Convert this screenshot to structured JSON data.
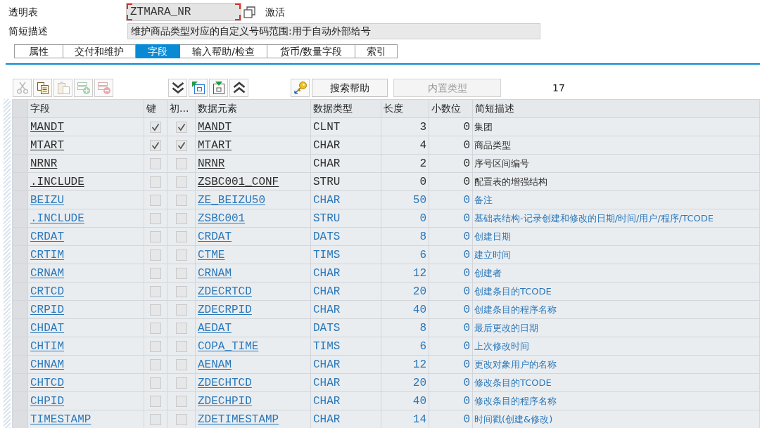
{
  "header": {
    "table_label": "透明表",
    "table_name": "ZTMARA_NR",
    "name_focused": true,
    "status": "激活",
    "description_label": "简短描述",
    "description": "维护商品类型对应的自定义号码范围:用于自动外部给号"
  },
  "tabs": [
    {
      "label": "属性",
      "selected": false
    },
    {
      "label": "交付和维护",
      "selected": false
    },
    {
      "label": "字段",
      "selected": true
    },
    {
      "label": "输入帮助/检查",
      "selected": false
    },
    {
      "label": "货币/数量字段",
      "selected": false
    },
    {
      "label": "索引",
      "selected": false
    }
  ],
  "toolbar": {
    "groups": [
      {
        "items": [
          {
            "kind": "cut",
            "disabled": true
          },
          {
            "kind": "copy",
            "disabled": false
          },
          {
            "kind": "paste",
            "disabled": true
          },
          {
            "kind": "insert_row",
            "disabled": true
          },
          {
            "kind": "delete_row",
            "disabled": true
          }
        ]
      },
      {
        "items": [
          {
            "kind": "expand_all",
            "disabled": false
          },
          {
            "kind": "flag_frame",
            "disabled": false
          },
          {
            "kind": "marker_frame",
            "disabled": false
          },
          {
            "kind": "collapse_all",
            "disabled": false
          }
        ]
      },
      {
        "items": [
          {
            "kind": "key",
            "disabled": false
          },
          {
            "kind": "text",
            "label": "搜索帮助",
            "disabled": false
          },
          {
            "kind": "text",
            "label": "内置类型",
            "disabled": true
          }
        ]
      }
    ],
    "count": "17"
  },
  "table": {
    "columns": [
      "字段",
      "键",
      "初...",
      "数据元素",
      "数据类型",
      "长度",
      "小数位",
      "简短描述"
    ],
    "rows": [
      {
        "field": "MANDT",
        "key": true,
        "column_3": true,
        "data_element": "MANDT",
        "data_type": "CLNT",
        "length": "3",
        "decimals": "0",
        "description": "集团",
        "color": "#2e2e2e"
      },
      {
        "field": "MTART",
        "key": true,
        "column_3": true,
        "data_element": "MTART",
        "data_type": "CHAR",
        "length": "4",
        "decimals": "0",
        "description": "商品类型",
        "color": "#2e2e2e"
      },
      {
        "field": "NRNR",
        "key": false,
        "column_3": false,
        "data_element": "NRNR",
        "data_type": "CHAR",
        "length": "2",
        "decimals": "0",
        "description": "序号区间编号",
        "color": "#2e2e2e"
      },
      {
        "field": ".INCLUDE",
        "key": false,
        "column_3": false,
        "data_element": "ZSBC001_CONF",
        "data_type": "STRU",
        "length": "0",
        "decimals": "0",
        "description": "配置表的增强结构",
        "color": "#2e2e2e"
      },
      {
        "field": "BEIZU",
        "key": false,
        "column_3": false,
        "data_element": "ZE_BEIZU50",
        "data_type": "CHAR",
        "length": "50",
        "decimals": "0",
        "description": "备注",
        "color": "#2a78ba"
      },
      {
        "field": ".INCLUDE",
        "key": false,
        "column_3": false,
        "data_element": "ZSBC001",
        "data_type": "STRU",
        "length": "0",
        "decimals": "0",
        "description": "基础表结构-记录创建和修改的日期/时间/用户/程序/TCODE",
        "color": "#2a78ba"
      },
      {
        "field": "CRDAT",
        "key": false,
        "column_3": false,
        "data_element": "CRDAT",
        "data_type": "DATS",
        "length": "8",
        "decimals": "0",
        "description": "创建日期",
        "color": "#2a78ba"
      },
      {
        "field": "CRTIM",
        "key": false,
        "column_3": false,
        "data_element": "CTME",
        "data_type": "TIMS",
        "length": "6",
        "decimals": "0",
        "description": "建立时间",
        "color": "#2a78ba"
      },
      {
        "field": "CRNAM",
        "key": false,
        "column_3": false,
        "data_element": "CRNAM",
        "data_type": "CHAR",
        "length": "12",
        "decimals": "0",
        "description": "创建者",
        "color": "#2a78ba"
      },
      {
        "field": "CRTCD",
        "key": false,
        "column_3": false,
        "data_element": "ZDECRTCD",
        "data_type": "CHAR",
        "length": "20",
        "decimals": "0",
        "description": "创建条目的TCODE",
        "color": "#2a78ba"
      },
      {
        "field": "CRPID",
        "key": false,
        "column_3": false,
        "data_element": "ZDECRPID",
        "data_type": "CHAR",
        "length": "40",
        "decimals": "0",
        "description": "创建条目的程序名称",
        "color": "#2a78ba"
      },
      {
        "field": "CHDAT",
        "key": false,
        "column_3": false,
        "data_element": "AEDAT",
        "data_type": "DATS",
        "length": "8",
        "decimals": "0",
        "description": "最后更改的日期",
        "color": "#2a78ba"
      },
      {
        "field": "CHTIM",
        "key": false,
        "column_3": false,
        "data_element": "COPA_TIME",
        "data_type": "TIMS",
        "length": "6",
        "decimals": "0",
        "description": "上次修改时间",
        "color": "#2a78ba"
      },
      {
        "field": "CHNAM",
        "key": false,
        "column_3": false,
        "data_element": "AENAM",
        "data_type": "CHAR",
        "length": "12",
        "decimals": "0",
        "description": "更改对象用户的名称",
        "color": "#2a78ba"
      },
      {
        "field": "CHTCD",
        "key": false,
        "column_3": false,
        "data_element": "ZDECHTCD",
        "data_type": "CHAR",
        "length": "20",
        "decimals": "0",
        "description": "修改条目的TCODE",
        "color": "#2a78ba"
      },
      {
        "field": "CHPID",
        "key": false,
        "column_3": false,
        "data_element": "ZDECHPID",
        "data_type": "CHAR",
        "length": "40",
        "decimals": "0",
        "description": "修改条目的程序名称",
        "color": "#2a78ba"
      },
      {
        "field": "TIMESTAMP",
        "key": false,
        "column_3": false,
        "data_element": "ZDETIMESTAMP",
        "data_type": "CHAR",
        "length": "14",
        "decimals": "0",
        "description": "时间戳(创建&修改)",
        "color": "#2a78ba"
      }
    ]
  }
}
